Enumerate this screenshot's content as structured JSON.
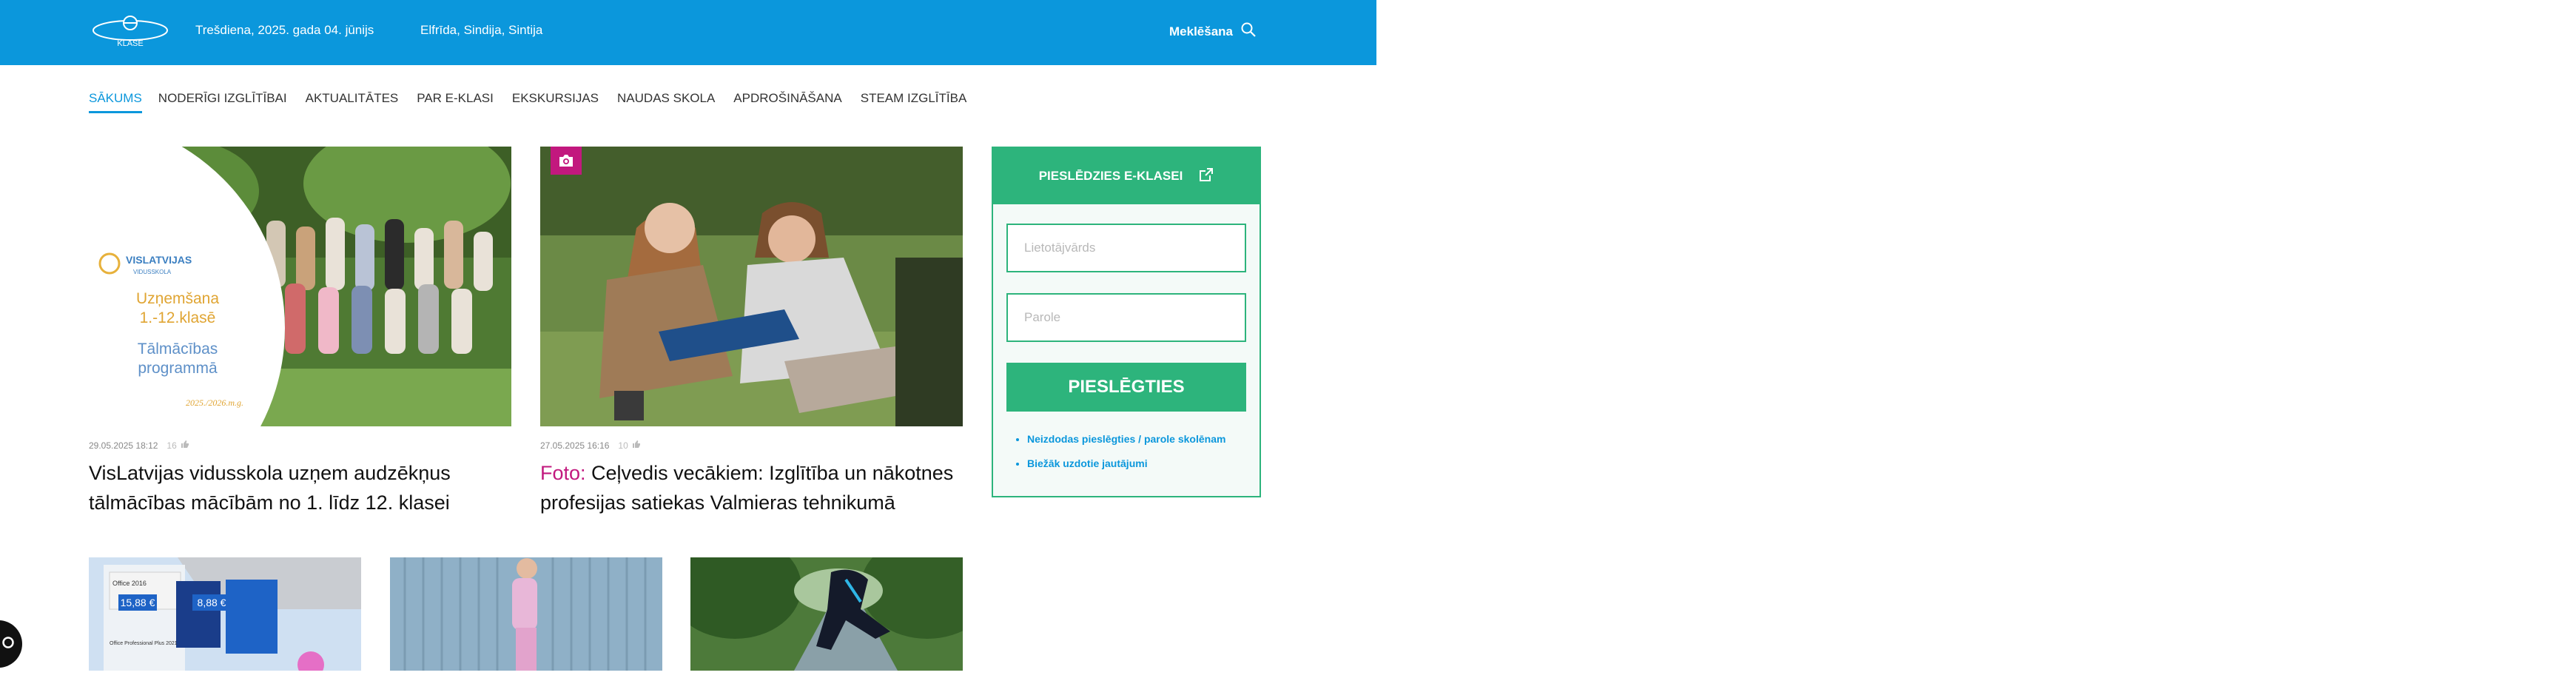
{
  "header": {
    "logo_text": "KLASE",
    "date": "Trešdiena, 2025. gada 04. jūnijs",
    "namedays": "Elfrīda, Sindija, Sintija",
    "search_label": "Meklēšana"
  },
  "nav": {
    "items": [
      {
        "label": "Sākums"
      },
      {
        "label": "Noderīgi izglītībai"
      },
      {
        "label": "Aktualitātes"
      },
      {
        "label": "Par e-klasi"
      },
      {
        "label": "Ekskursijas"
      },
      {
        "label": "Naudas skola"
      },
      {
        "label": "Apdrošināšana"
      },
      {
        "label": "STEAM izglītība"
      }
    ]
  },
  "articles": [
    {
      "date": "29.05.2025 18:12",
      "likes": "16",
      "title": "VisLatvijas vidusskola uzņem audzēkņus tālmācības mācībām no 1. līdz 12. klasei",
      "image_overlay": {
        "brand": "VISLATVIJAS",
        "brand_sub": "VIDUSSKOLA",
        "line1": "Uzņemšana",
        "line2": "1.-12.klasē",
        "line3": "Tālmācības",
        "line4": "programmā",
        "year": "2025./2026.m.g."
      }
    },
    {
      "date": "27.05.2025 16:16",
      "likes": "10",
      "tag": "Foto:",
      "title": " Ceļvedis vecākiem: Izglītība un nākotnes profesijas satiekas Valmieras tehnikumā"
    }
  ],
  "promo_image": {
    "badge1": "15,88 €",
    "badge2": "8,88 €",
    "product1": "Office 2016",
    "product2": "Office Professional Plus 2021"
  },
  "login": {
    "header_label": "Pieslēdzies e-klasei",
    "username_placeholder": "Lietotājvārds",
    "password_placeholder": "Parole",
    "button_label": "Pieslēgties",
    "links": [
      "Neizdodas pieslēgties / parole skolēnam",
      "Biežāk uzdotie jautājumi"
    ]
  },
  "colors": {
    "brand_blue": "#0b97dc",
    "login_green": "#2db47c",
    "tag_magenta": "#c2187e"
  }
}
